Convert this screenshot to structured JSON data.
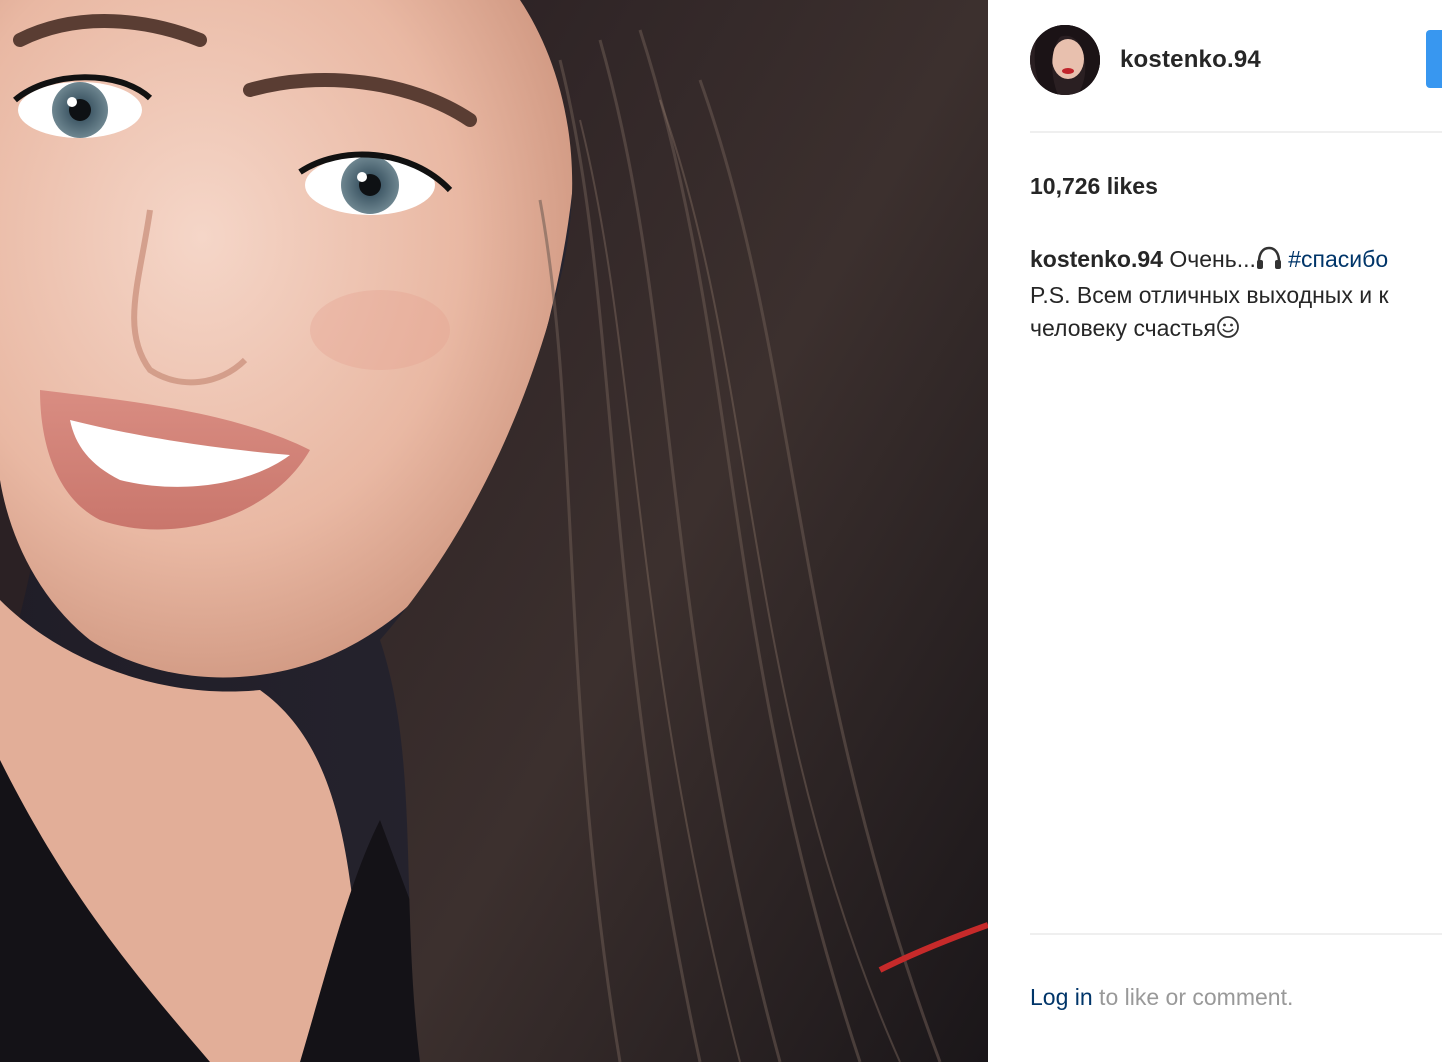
{
  "post": {
    "username": "kostenko.94",
    "likes_text": "10,726 likes",
    "caption": {
      "username": "kostenko.94",
      "text_start": "Очень...",
      "emoji_icon": "headphones-icon",
      "hashtag": "#спасибо",
      "line2": "P.S. Всем отличных выходных и к",
      "line3": "человеку счастья",
      "line3_emoji_icon": "smiling-face-icon"
    },
    "login_prompt": {
      "link_text": "Log in",
      "rest_text": " to like or comment."
    }
  },
  "colors": {
    "accent_blue": "#3897f0",
    "link_blue": "#003569",
    "text_dark": "#262626",
    "text_muted": "#999999",
    "divider": "#efefef"
  }
}
